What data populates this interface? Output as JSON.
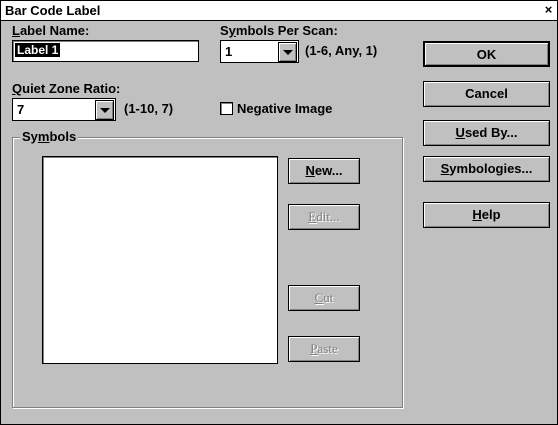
{
  "window": {
    "title": "Bar Code Label",
    "close_glyph": "×"
  },
  "label_name": {
    "label": "Label Name:",
    "value": "Label 1"
  },
  "symbols_per_scan": {
    "label": "Symbols Per Scan:",
    "value": "1",
    "hint": "(1-6, Any, 1)"
  },
  "quiet_zone": {
    "label": "Quiet Zone Ratio:",
    "value": "7",
    "hint": "(1-10, 7)"
  },
  "negative_image": {
    "label": "Negative Image",
    "checked": false
  },
  "symbols_group": {
    "title": "Symbols",
    "items": []
  },
  "buttons": {
    "ok": "OK",
    "cancel": "Cancel",
    "used_by": "Used By...",
    "symbologies": "Symbologies...",
    "help": "Help",
    "new": "New...",
    "edit": "Edit...",
    "cut": "Cut",
    "paste": "Paste"
  }
}
